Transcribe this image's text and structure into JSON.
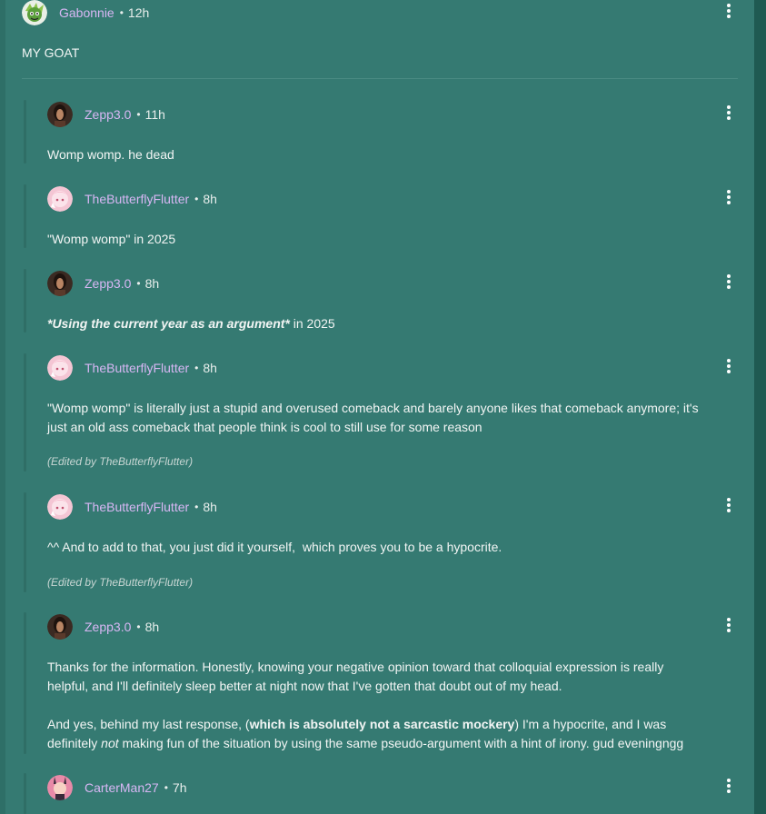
{
  "top_comment": {
    "author": "Gabonnie",
    "time": "12h",
    "text": "MY GOAT"
  },
  "replies": [
    {
      "author": "Zepp3.0",
      "time": "11h",
      "text": "Womp womp. he dead"
    },
    {
      "author": "TheButterflyFlutter",
      "time": "8h",
      "text": "\"Womp womp\"  in 2025"
    },
    {
      "author": "Zepp3.0",
      "time": "8h",
      "text_bold_italic": "*Using the current year as an argument*",
      "text_rest": " in 2025"
    },
    {
      "author": "TheButterflyFlutter",
      "time": "8h",
      "text_line1": "\"Womp womp\" is literally just a stupid and overused comeback and barely anyone likes that comeback anymore; it's",
      "text_line2": "just an old ass comeback that people think is cool to still use for some reason",
      "edited": "(Edited by TheButterflyFlutter)"
    },
    {
      "author": "TheButterflyFlutter",
      "time": "8h",
      "text": "^^ And to add to that, you just did it yourself,  which proves you to be a hypocrite.",
      "edited": "(Edited by TheButterflyFlutter)"
    },
    {
      "author": "Zepp3.0",
      "time": "8h",
      "para1_line1": "Thanks for the information. Honestly, knowing your negative opinion toward that colloquial expression is really",
      "para1_line2": "helpful, and I'll definitely sleep better at night now that I've gotten that doubt out of my head.",
      "para2_a": "And yes, behind my last response, (",
      "para2_bold": "which is absolutely not a sarcastic mockery",
      "para2_b": ") I'm a hypocrite, and I was",
      "para2_c": "definitely ",
      "para2_italic": "not",
      "para2_d": " making fun of the situation by using the same pseudo-argument with a hint of irony. gud eveningngg"
    },
    {
      "author": "CarterMan27",
      "time": "7h"
    }
  ],
  "separator": "•",
  "colors": {
    "background": "#357a72",
    "author": "#d8b7f4",
    "text": "#f2f5f4"
  },
  "icons": {
    "menu": "more-vertical-icon"
  }
}
